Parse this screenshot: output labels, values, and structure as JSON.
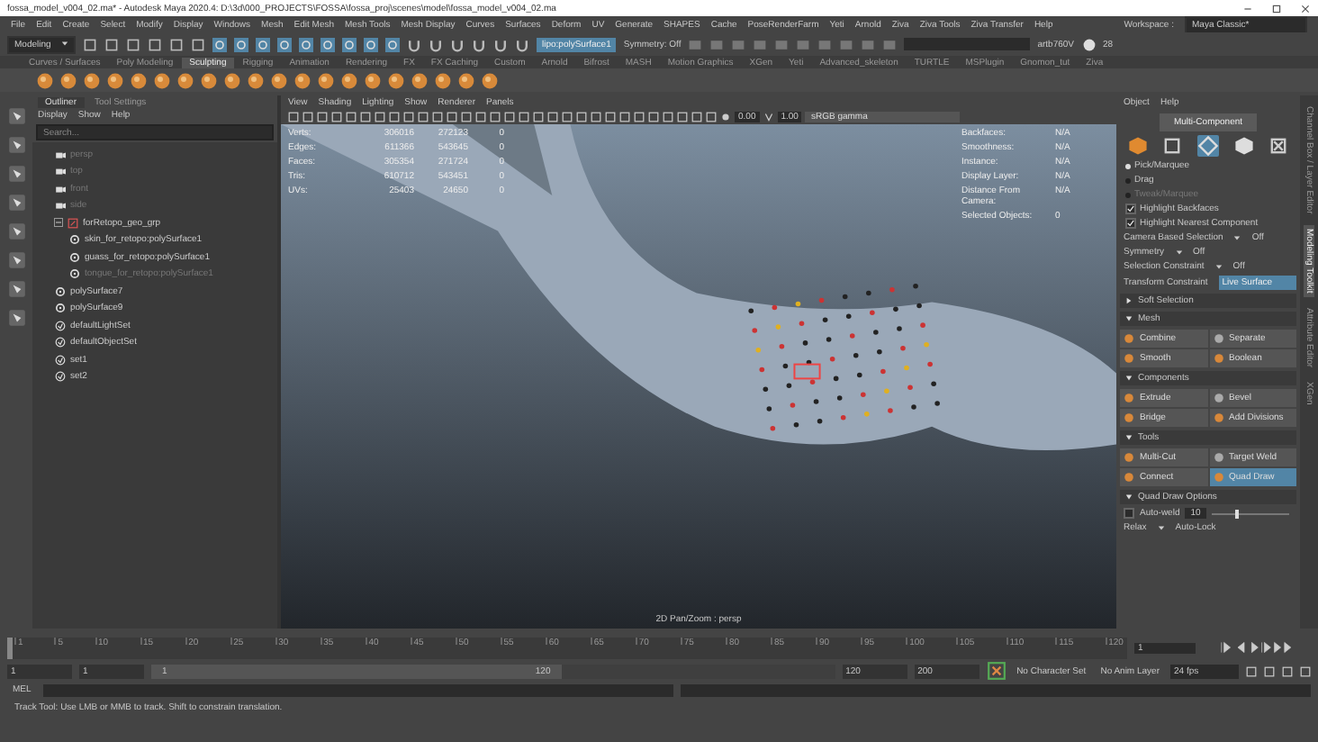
{
  "window": {
    "title": "fossa_model_v004_02.ma* - Autodesk Maya 2020.4: D:\\3d\\000_PROJECTS\\FOSSA\\fossa_proj\\scenes\\model\\fossa_model_v004_02.ma"
  },
  "menu_bar": [
    "File",
    "Edit",
    "Create",
    "Select",
    "Modify",
    "Display",
    "Windows",
    "Mesh",
    "Edit Mesh",
    "Mesh Tools",
    "Mesh Display",
    "Curves",
    "Surfaces",
    "Deform",
    "UV",
    "Generate",
    "SHAPES",
    "Cache",
    "PoseRenderFarm",
    "Yeti",
    "Arnold",
    "Ziva",
    "Ziva Tools",
    "Ziva Transfer",
    "Help"
  ],
  "status_line": {
    "mode": "Modeling",
    "object_field": "lipo:polySurface1",
    "symmetry": "Symmetry: Off",
    "workspace_label": "Workspace :",
    "workspace": "Maya Classic*",
    "user": "artb760V",
    "count": "28"
  },
  "shelf_tabs": [
    {
      "label": "Curves / Surfaces",
      "selected": false
    },
    {
      "label": "Poly Modeling",
      "selected": false
    },
    {
      "label": "Sculpting",
      "selected": true
    },
    {
      "label": "Rigging",
      "selected": false
    },
    {
      "label": "Animation",
      "selected": false
    },
    {
      "label": "Rendering",
      "selected": false
    },
    {
      "label": "FX",
      "selected": false
    },
    {
      "label": "FX Caching",
      "selected": false
    },
    {
      "label": "Custom",
      "selected": false
    },
    {
      "label": "Arnold",
      "selected": false
    },
    {
      "label": "Bifrost",
      "selected": false
    },
    {
      "label": "MASH",
      "selected": false
    },
    {
      "label": "Motion Graphics",
      "selected": false
    },
    {
      "label": "XGen",
      "selected": false
    },
    {
      "label": "Yeti",
      "selected": false
    },
    {
      "label": "Advanced_skeleton",
      "selected": false
    },
    {
      "label": "TURTLE",
      "selected": false
    },
    {
      "label": "MSPlugin",
      "selected": false
    },
    {
      "label": "Gnomon_tut",
      "selected": false
    },
    {
      "label": "Ziva",
      "selected": false
    }
  ],
  "outliner": {
    "tabs": [
      {
        "label": "Outliner",
        "selected": true
      },
      {
        "label": "Tool Settings",
        "selected": false
      }
    ],
    "menu": [
      "Display",
      "Show",
      "Help"
    ],
    "search": {
      "placeholder": "Search..."
    },
    "items": [
      {
        "label": "persp",
        "kind": "camera",
        "dimmed": true
      },
      {
        "label": "top",
        "kind": "camera",
        "dimmed": true
      },
      {
        "label": "front",
        "kind": "camera",
        "dimmed": true
      },
      {
        "label": "side",
        "kind": "camera",
        "dimmed": true
      },
      {
        "label": "forRetopo_geo_grp",
        "kind": "group",
        "dimmed": false,
        "expanded": true,
        "children": [
          {
            "label": "skin_for_retopo:polySurface1",
            "kind": "mesh",
            "dimmed": false
          },
          {
            "label": "guass_for_retopo:polySurface1",
            "kind": "mesh",
            "dimmed": false
          },
          {
            "label": "tongue_for_retopo:polySurface1",
            "kind": "mesh",
            "dimmed": true
          }
        ]
      },
      {
        "label": "polySurface7",
        "kind": "mesh",
        "dimmed": false
      },
      {
        "label": "polySurface9",
        "kind": "mesh",
        "dimmed": false
      },
      {
        "label": "defaultLightSet",
        "kind": "set",
        "dimmed": false
      },
      {
        "label": "defaultObjectSet",
        "kind": "set",
        "dimmed": false
      },
      {
        "label": "set1",
        "kind": "set",
        "dimmed": false
      },
      {
        "label": "set2",
        "kind": "set",
        "dimmed": false
      }
    ]
  },
  "viewport": {
    "menu": [
      "View",
      "Shading",
      "Lighting",
      "Show",
      "Renderer",
      "Panels"
    ],
    "exposure": "0.00",
    "gamma": "1.00",
    "color_space": "sRGB gamma",
    "stats": [
      {
        "label": "Verts:",
        "values": [
          "306016",
          "272123",
          "0"
        ]
      },
      {
        "label": "Edges:",
        "values": [
          "611366",
          "543645",
          "0"
        ]
      },
      {
        "label": "Faces:",
        "values": [
          "305354",
          "271724",
          "0"
        ]
      },
      {
        "label": "Tris:",
        "values": [
          "610712",
          "543451",
          "0"
        ]
      },
      {
        "label": "UVs:",
        "values": [
          "25403",
          "24650",
          "0"
        ]
      }
    ],
    "info": [
      {
        "label": "Backfaces:",
        "value": "N/A"
      },
      {
        "label": "Smoothness:",
        "value": "N/A"
      },
      {
        "label": "Instance:",
        "value": "N/A"
      },
      {
        "label": "Display Layer:",
        "value": "N/A"
      },
      {
        "label": "Distance From Camera:",
        "value": "N/A"
      },
      {
        "label": "Selected Objects:",
        "value": "0"
      }
    ],
    "camera_label": "2D Pan/Zoom : persp"
  },
  "toolkit": {
    "menu": [
      "Object",
      "Help"
    ],
    "mode_button": "Multi-Component",
    "selection_modes": [
      {
        "selected": false
      },
      {
        "selected": false
      },
      {
        "selected": true
      },
      {
        "selected": false
      },
      {
        "selected": false
      }
    ],
    "pick_modes": [
      {
        "label": "Pick/Marquee",
        "selected": true,
        "disabled": false
      },
      {
        "label": "Drag",
        "selected": false,
        "disabled": false
      },
      {
        "label": "Tweak/Marquee",
        "selected": false,
        "disabled": true
      }
    ],
    "options": [
      {
        "label": "Highlight Backfaces",
        "checked": true
      },
      {
        "label": "Highlight Nearest Component",
        "checked": true
      }
    ],
    "settings": [
      {
        "label": "Camera Based Selection",
        "value": "Off"
      },
      {
        "label": "Symmetry",
        "value": "Off"
      },
      {
        "label": "Selection Constraint",
        "value": "Off"
      }
    ],
    "transform_constraint": {
      "label": "Transform Constraint",
      "value": "Live Surface"
    },
    "sections": [
      {
        "title": "Soft Selection",
        "expanded": false
      },
      {
        "title": "Mesh",
        "expanded": true,
        "buttons": [
          {
            "label": "Combine",
            "selected": false
          },
          {
            "label": "Separate",
            "selected": false
          },
          {
            "label": "Smooth",
            "selected": false
          },
          {
            "label": "Boolean",
            "selected": false
          }
        ]
      },
      {
        "title": "Components",
        "expanded": true,
        "buttons": [
          {
            "label": "Extrude",
            "selected": false
          },
          {
            "label": "Bevel",
            "selected": false
          },
          {
            "label": "Bridge",
            "selected": false
          },
          {
            "label": "Add Divisions",
            "selected": false
          }
        ]
      },
      {
        "title": "Tools",
        "expanded": true,
        "buttons": [
          {
            "label": "Multi-Cut",
            "selected": false
          },
          {
            "label": "Target Weld",
            "selected": false
          },
          {
            "label": "Connect",
            "selected": false
          },
          {
            "label": "Quad Draw",
            "selected": true
          }
        ]
      },
      {
        "title": "Quad Draw Options",
        "expanded": true
      }
    ],
    "auto_weld": {
      "label": "Auto-weld",
      "checked": false,
      "value": "10",
      "level": 0.3
    },
    "relax": {
      "label": "Relax",
      "value": "Auto-Lock"
    }
  },
  "side_tabs": [
    {
      "label": "Channel Box / Layer Editor",
      "selected": false
    },
    {
      "label": "Modeling Toolkit",
      "selected": true
    },
    {
      "label": "Attribute Editor",
      "selected": false
    },
    {
      "label": "XGen",
      "selected": false
    }
  ],
  "timeline": {
    "ticks": [
      "1",
      "5",
      "10",
      "15",
      "20",
      "25",
      "30",
      "35",
      "40",
      "45",
      "50",
      "55",
      "60",
      "65",
      "70",
      "75",
      "80",
      "85",
      "90",
      "95",
      "100",
      "105",
      "110",
      "115",
      "120"
    ],
    "current_frame": "1",
    "level": 0
  },
  "range": {
    "start": "1",
    "playback_start": "1",
    "slider_start": "1",
    "slider_end": "120",
    "level": 0.6,
    "playback_end": "120",
    "end": "200",
    "character_set": "No Character Set",
    "anim_layer": "No Anim Layer",
    "fps": "24 fps"
  },
  "command_line": {
    "label": "MEL"
  },
  "help_line": "Track Tool: Use LMB or MMB to track. Shift to constrain translation."
}
